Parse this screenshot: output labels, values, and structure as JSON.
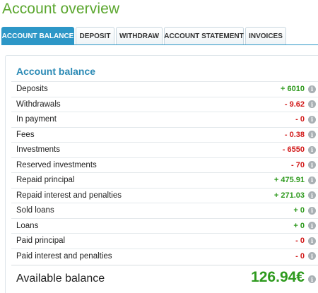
{
  "page": {
    "title": "Account overview"
  },
  "tabs": [
    {
      "label": "ACCOUNT BALANCE",
      "active": true
    },
    {
      "label": "DEPOSIT",
      "active": false
    },
    {
      "label": "WITHDRAW",
      "active": false
    },
    {
      "label": "ACCOUNT STATEMENT",
      "active": false
    },
    {
      "label": "INVOICES",
      "active": false
    }
  ],
  "balance": {
    "title": "Account balance",
    "rows": [
      {
        "label": "Deposits",
        "value": "+ 6010",
        "sign": "pos"
      },
      {
        "label": "Withdrawals",
        "value": "- 9.62",
        "sign": "neg"
      },
      {
        "label": "In payment",
        "value": "- 0",
        "sign": "neg"
      },
      {
        "label": "Fees",
        "value": "- 0.38",
        "sign": "neg"
      },
      {
        "label": "Investments",
        "value": "- 6550",
        "sign": "neg"
      },
      {
        "label": "Reserved investments",
        "value": "- 70",
        "sign": "neg"
      },
      {
        "label": "Repaid principal",
        "value": "+ 475.91",
        "sign": "pos"
      },
      {
        "label": "Repaid interest and penalties",
        "value": "+ 271.03",
        "sign": "pos"
      },
      {
        "label": "Sold loans",
        "value": "+ 0",
        "sign": "pos"
      },
      {
        "label": "Loans",
        "value": "+ 0",
        "sign": "pos"
      },
      {
        "label": "Paid principal",
        "value": "- 0",
        "sign": "neg"
      },
      {
        "label": "Paid interest and penalties",
        "value": "- 0",
        "sign": "neg"
      }
    ],
    "available": {
      "label": "Available balance",
      "value": "126.94€"
    },
    "info_icon": "info-icon",
    "info_glyph": "i"
  },
  "colors": {
    "title_green": "#5aa62d",
    "tab_active": "#2d97c7",
    "positive": "#2e9a1e",
    "negative": "#d21919",
    "section_title": "#2b8ab5"
  }
}
